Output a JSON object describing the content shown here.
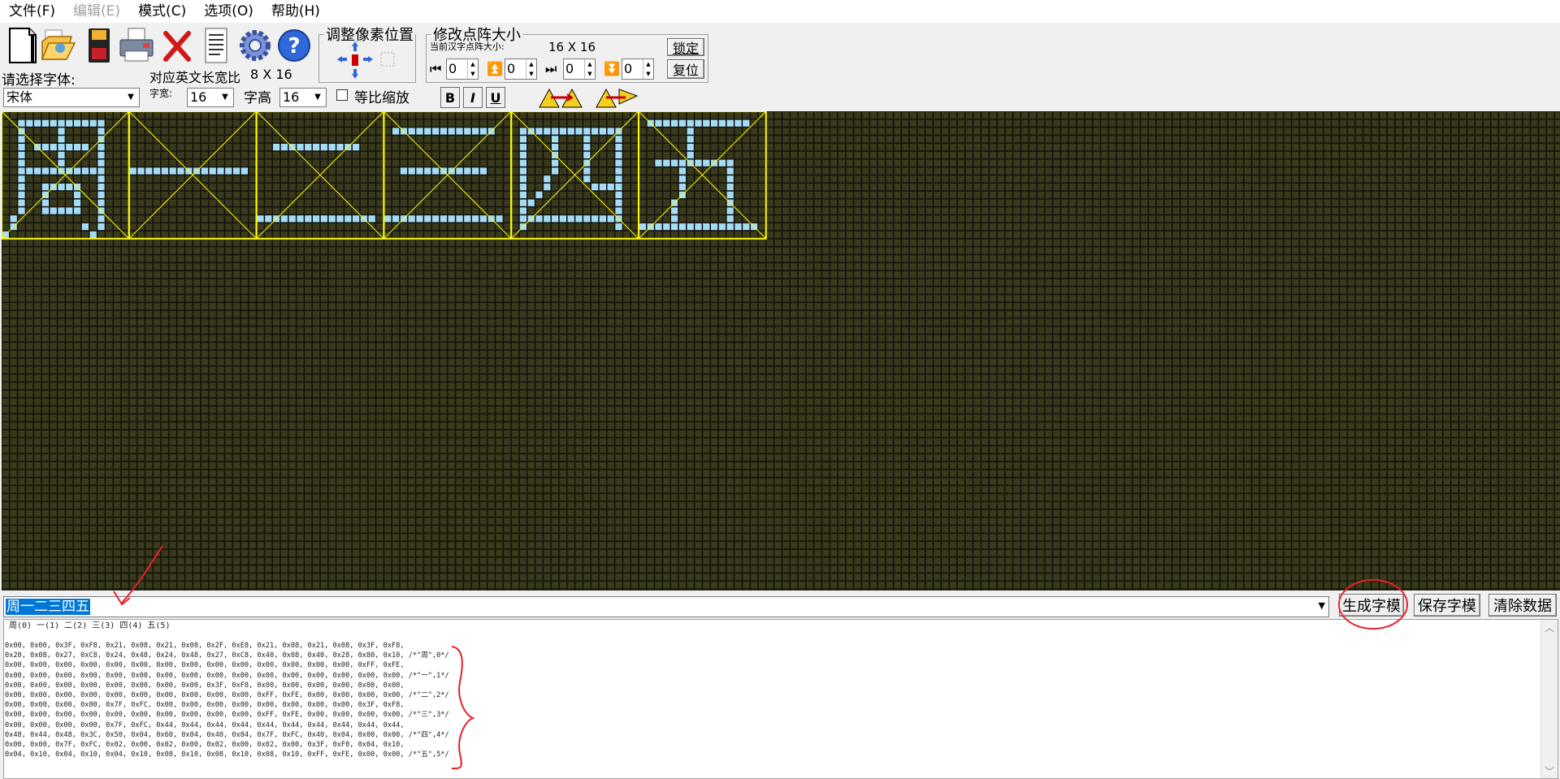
{
  "menu": [
    {
      "label": "文件(F)",
      "disabled": false
    },
    {
      "label": "编辑(E)",
      "disabled": true
    },
    {
      "label": "模式(C)",
      "disabled": false
    },
    {
      "label": "选项(O)",
      "disabled": false
    },
    {
      "label": "帮助(H)",
      "disabled": false
    }
  ],
  "toolbar": {
    "icons": [
      "new-file-icon",
      "open-folder-icon",
      "save-disk-icon",
      "print-icon",
      "delete-icon",
      "notes-icon",
      "settings-gear-icon",
      "help-icon"
    ],
    "font_label": "请选择字体:",
    "ratio_label": "对应英文长宽比",
    "ratio_value": "8 X 16",
    "font_value": "宋体",
    "width_label": "字宽:",
    "width_value": "16",
    "height_label": "字高",
    "height_value": "16",
    "proportional_label": "等比缩放",
    "proportional_checked": false,
    "bold_label": "B",
    "italic_label": "I",
    "underline_label": "U"
  },
  "pixel_group": {
    "title": "调整像素位置"
  },
  "matrix_group": {
    "title": "修改点阵大小",
    "current_label": "当前汉字点阵大小:",
    "current_value": "16 X 16",
    "lock_label": "锁定",
    "reset_label": "复位",
    "spins": [
      "0",
      "0",
      "0",
      "0"
    ]
  },
  "canvas": {
    "grid_color": "#3a3a1a",
    "lit_color": "#a5dcf5",
    "frame_color": "#ffff00",
    "chars": [
      "周",
      "一",
      "二",
      "三",
      "四",
      "五"
    ]
  },
  "input": {
    "value": "周一二三四五"
  },
  "buttons": {
    "generate": "生成字模",
    "save": "保存字模",
    "clear": "清除数据"
  },
  "output": {
    "header": "周(0)  一(1)  二(2)  三(3)  四(4)  五(5)",
    "lines": [
      "0x00, 0x00, 0x3F, 0xF8, 0x21, 0x08, 0x21, 0x08, 0x2F, 0xE8, 0x21, 0x08, 0x21, 0x08, 0x3F, 0xF8,",
      "0x20, 0x08, 0x27, 0xC8, 0x24, 0x48, 0x24, 0x48, 0x27, 0xC8, 0x40, 0x08, 0x40, 0x28, 0x80, 0x10, /*\"周\",0*/",
      "0x00, 0x00, 0x00, 0x00, 0x00, 0x00, 0x00, 0x00, 0x00, 0x00, 0x00, 0x00, 0x00, 0x00, 0xFF, 0xFE,",
      "0x00, 0x00, 0x00, 0x00, 0x00, 0x00, 0x00, 0x00, 0x00, 0x00, 0x00, 0x00, 0x00, 0x00, 0x00, 0x00, /*\"一\",1*/",
      "0x00, 0x00, 0x00, 0x00, 0x00, 0x00, 0x00, 0x00, 0x3F, 0xF8, 0x00, 0x00, 0x00, 0x00, 0x00, 0x00,",
      "0x00, 0x00, 0x00, 0x00, 0x00, 0x00, 0x00, 0x00, 0x00, 0x00, 0xFF, 0xFE, 0x00, 0x00, 0x00, 0x00, /*\"二\",2*/",
      "0x00, 0x00, 0x00, 0x00, 0x7F, 0xFC, 0x00, 0x00, 0x00, 0x00, 0x00, 0x00, 0x00, 0x00, 0x3F, 0xF8,",
      "0x00, 0x00, 0x00, 0x00, 0x00, 0x00, 0x00, 0x00, 0x00, 0x00, 0xFF, 0xFE, 0x00, 0x00, 0x00, 0x00, /*\"三\",3*/",
      "0x00, 0x00, 0x00, 0x00, 0x7F, 0xFC, 0x44, 0x44, 0x44, 0x44, 0x44, 0x44, 0x44, 0x44, 0x44, 0x44,",
      "0x48, 0x44, 0x48, 0x3C, 0x50, 0x04, 0x60, 0x04, 0x40, 0x04, 0x7F, 0xFC, 0x40, 0x04, 0x00, 0x00, /*\"四\",4*/",
      "0x00, 0x00, 0x7F, 0xFC, 0x02, 0x00, 0x02, 0x00, 0x02, 0x00, 0x02, 0x00, 0x3F, 0xF0, 0x04, 0x10,",
      "0x04, 0x10, 0x04, 0x10, 0x04, 0x10, 0x08, 0x10, 0x08, 0x10, 0x08, 0x10, 0xFF, 0xFE, 0x00, 0x00, /*\"五\",5*/"
    ]
  }
}
